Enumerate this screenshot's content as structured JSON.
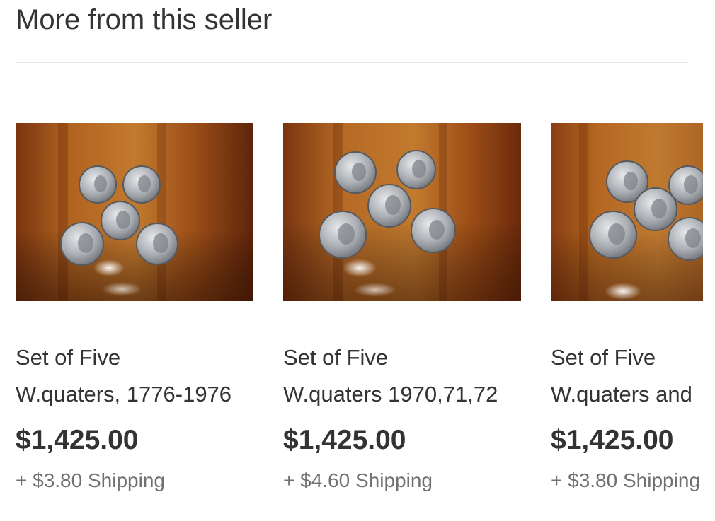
{
  "section": {
    "title": "More from this seller"
  },
  "items": [
    {
      "title_line1": "Set of Five",
      "title_line2": "W.quaters, 1776-1976",
      "price": "$1,425.00",
      "shipping": "+ $3.80 Shipping"
    },
    {
      "title_line1": "Set of Five",
      "title_line2": "W.quaters 1970,71,72",
      "price": "$1,425.00",
      "shipping": "+ $4.60 Shipping"
    },
    {
      "title_line1": "Set of Five",
      "title_line2": "W.quaters and",
      "price": "$1,425.00",
      "shipping": "+ $3.80 Shipping"
    }
  ]
}
